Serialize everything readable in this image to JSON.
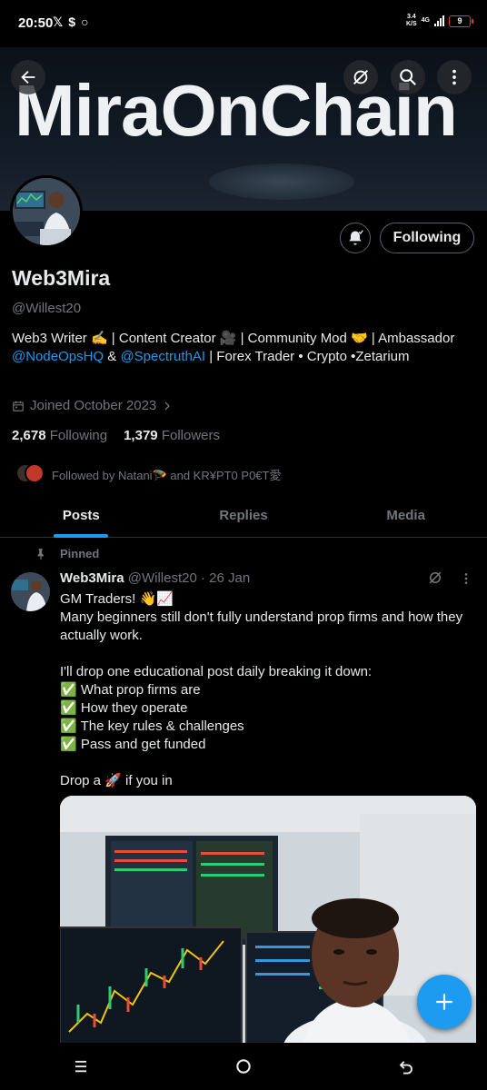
{
  "status_bar": {
    "time": "20:50",
    "left_icons": [
      "x-logo-icon",
      "s-app-icon",
      "circle-app-icon"
    ],
    "speed": "3.4",
    "speed_unit": "K/S",
    "network": "4G",
    "battery": "9"
  },
  "banner": {
    "text": "MiraOnChain"
  },
  "profile": {
    "display_name": "Web3Mira",
    "handle": "@Willest20",
    "bio_parts": {
      "p1": "Web3 Writer ✍️ | Content Creator 🎥 | Community Mod 🤝 | Ambassador ",
      "link1": "@NodeOpsHQ",
      "p2": " & ",
      "link2": "@SpectruthAI",
      "p3": " | Forex Trader • Crypto •Zetarium"
    },
    "joined": "Joined October 2023",
    "following_count": "2,678",
    "following_label": "Following",
    "followers_count": "1,379",
    "followers_label": "Followers",
    "followed_by": "Followed by Natani🪂 and KR¥PT0 P0€T愛",
    "follow_button": "Following"
  },
  "tabs": [
    {
      "label": "Posts",
      "active": true
    },
    {
      "label": "Replies",
      "active": false
    },
    {
      "label": "Media",
      "active": false
    }
  ],
  "post": {
    "pinned_label": "Pinned",
    "author": "Web3Mira",
    "handle": "@Willest20",
    "date": "· 26 Jan",
    "lines": {
      "l1": "GM Traders! 👋📈",
      "l2": "Many beginners still don't fully understand prop firms and how they actually work.",
      "l3": "I'll drop one educational post daily breaking it down:",
      "l4": "✅ What prop firms are",
      "l5": "✅ How they operate",
      "l6": "✅ The key rules & challenges",
      "l7": "✅ Pass and get funded",
      "l8": "Drop a 🚀 if you in"
    }
  },
  "colors": {
    "accent": "#1d9bf0",
    "secondary_text": "#71767b",
    "primary_text": "#e7e9ea",
    "divider": "#2f3336"
  }
}
